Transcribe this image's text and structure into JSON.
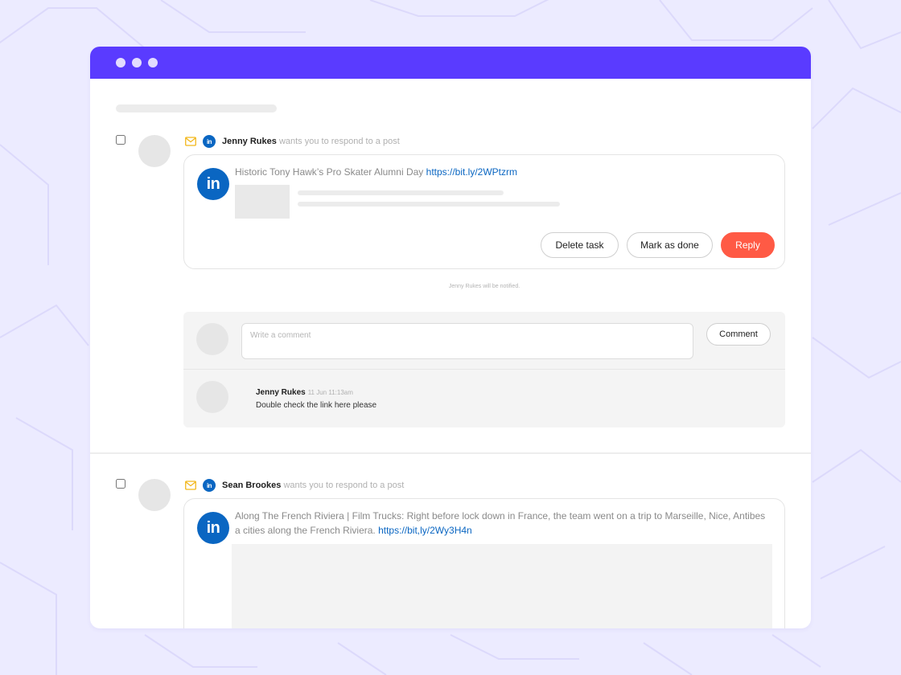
{
  "colors": {
    "background": "#ecebff",
    "titlebar": "#5a3bff",
    "linkedin": "#0a66c2",
    "reply_button": "#ff5a45",
    "link": "#0a66c2"
  },
  "icons": {
    "mail": "mail-icon",
    "linkedin": "linkedin-icon",
    "window_dots": [
      "window-dot-icon",
      "window-dot-icon",
      "window-dot-icon"
    ]
  },
  "linkedin_logo_text": "in",
  "tasks": [
    {
      "author": "Jenny Rukes",
      "action": "wants you to respond to a post",
      "post_text": "Historic Tony Hawk’s Pro Skater Alumni Day",
      "post_link": "https://bit.ly/2WPtzrm",
      "buttons": {
        "delete": "Delete task",
        "mark_done": "Mark as done",
        "reply": "Reply"
      },
      "notice": "Jenny Rukes will be notified.",
      "comment_box": {
        "placeholder": "Write a comment",
        "value": "",
        "submit_label": "Comment"
      },
      "comments": [
        {
          "author": "Jenny Rukes",
          "time": "11 Jun 11:13am",
          "text": "Double check the link here please"
        }
      ]
    },
    {
      "author": "Sean Brookes",
      "action": "wants you to respond to a post",
      "post_text_line1": "Along The French Riviera | Film Trucks: Right before lock down in France, the team went on a trip to Marseille, Nice, Antibes",
      "post_text_line2": "a cities along the French Riviera.",
      "post_link": "https://bit,ly/2Wy3H4n"
    }
  ]
}
